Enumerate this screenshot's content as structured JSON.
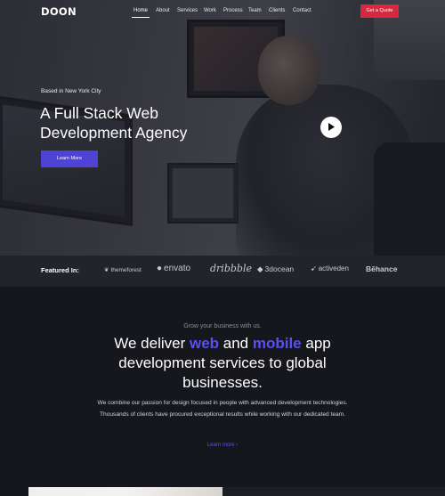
{
  "nav": {
    "logo": "DOON",
    "items": [
      {
        "label": "Home",
        "active": true
      },
      {
        "label": "About"
      },
      {
        "label": "Services"
      },
      {
        "label": "Work"
      },
      {
        "label": "Process"
      },
      {
        "label": "Team"
      },
      {
        "label": "Clients"
      },
      {
        "label": "Contact"
      }
    ],
    "cta": "Get a Quote"
  },
  "hero": {
    "tagline": "Based in New York City",
    "headline_line1": "A Full Stack Web",
    "headline_line2": "Development Agency",
    "button": "Learn More",
    "play_icon": "play-icon"
  },
  "featured": {
    "label": "Featured In:",
    "brands": [
      "themeforest",
      "envato",
      "dribbble",
      "3docean",
      "activeden",
      "Bēhance"
    ]
  },
  "intro": {
    "kicker": "Grow your business with us.",
    "h_part1": "We deliver ",
    "h_web": "web",
    "h_part2": " and ",
    "h_mobile": "mobile",
    "h_part3": " app development services to global businesses.",
    "description": "We combine our passion for design focused in people with advanced development technologies. Thousands of clients have procured exceptional results while working with our dedicated team.",
    "link": "Learn more"
  },
  "colors": {
    "accent": "#5a4ff0",
    "cta_red": "#d8283f",
    "background": "#16171d"
  }
}
